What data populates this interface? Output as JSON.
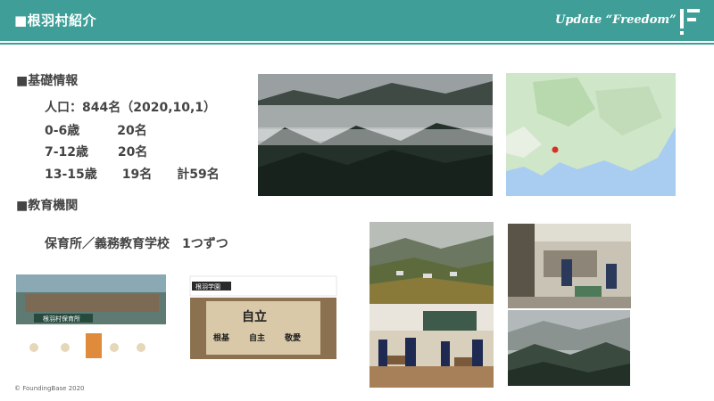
{
  "header": {
    "title": "■根羽村紹介",
    "tagline": "Update “Freedom”"
  },
  "basic_info": {
    "heading": "■基礎情報",
    "lines": [
      "人口：844名（2020,10,1）",
      "0-6歳　　　20名",
      "7-12歳　　 20名",
      "13-15歳　　19名　　計59名"
    ]
  },
  "education": {
    "heading": "■教育機関",
    "line": "保育所／義務教育学校　1つずつ"
  },
  "screenshots": {
    "nursery_sign": "根羽村保育所",
    "school_banner": "根羽学園",
    "school_motto": "自立",
    "school_words": [
      "根基",
      "自主",
      "敬愛"
    ]
  },
  "footer": {
    "copyright": "© FoundingBase 2020"
  },
  "colors": {
    "header_bg": "#3f9f98",
    "text": "#444444"
  }
}
